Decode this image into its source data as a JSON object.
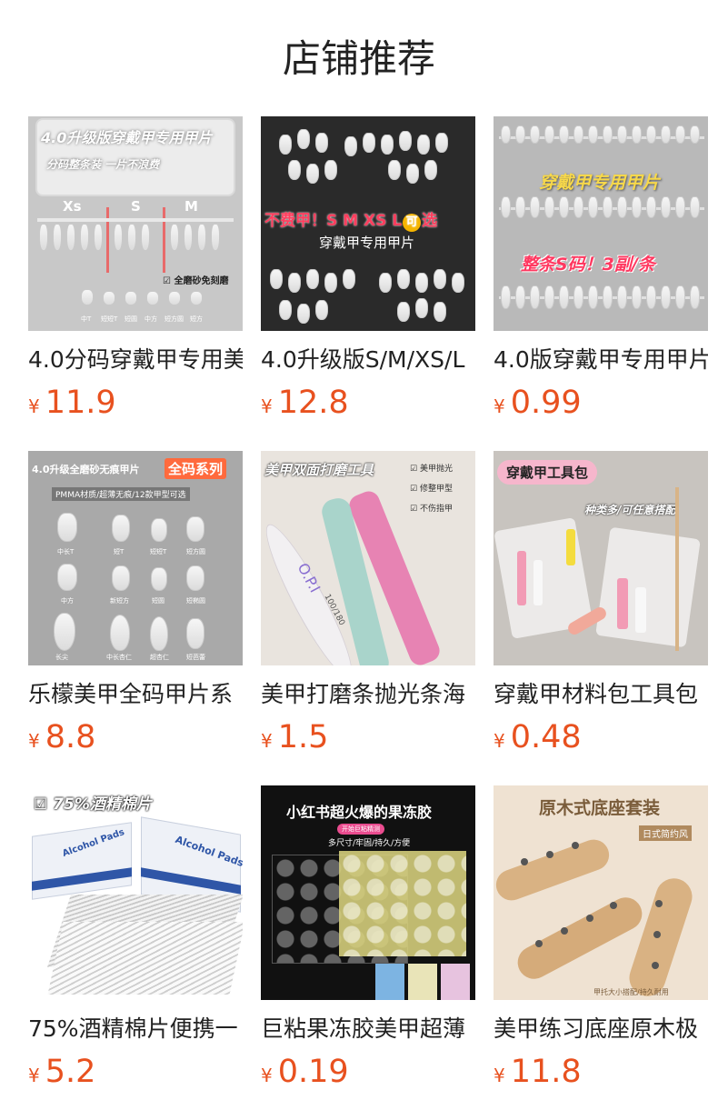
{
  "section": {
    "title": "店铺推荐"
  },
  "products": [
    {
      "name": "4.0分码穿戴甲专用美",
      "currency": "¥",
      "price": "11.9",
      "image_text": {
        "banner": "4.0升级版穿戴甲专用甲片",
        "sub": "分码整条装 一片不浪费",
        "sizes": [
          "Xs",
          "S",
          "M"
        ],
        "check": "全磨砂免刻磨",
        "shapes": [
          "中T",
          "短短T",
          "短圆",
          "中方",
          "短方圆",
          "短方"
        ]
      },
      "colors": {
        "bg": "#c8c8c8"
      }
    },
    {
      "name": "4.0升级版S/M/XS/L",
      "currency": "¥",
      "price": "12.8",
      "image_text": {
        "banner": "不费甲！S M XS L",
        "badge": "可",
        "banner_end": "选",
        "sub": "穿戴甲专用甲片"
      },
      "colors": {
        "bg": "#2a2a2a"
      }
    },
    {
      "name": "4.0版穿戴甲专用甲片",
      "currency": "¥",
      "price": "0.99",
      "image_text": {
        "banner": "穿戴甲专用甲片",
        "sub": "整条S码！3副/条"
      },
      "colors": {
        "bg": "#b9b9b9"
      }
    },
    {
      "name": "乐檬美甲全码甲片系",
      "currency": "¥",
      "price": "8.8",
      "image_text": {
        "banner": "4.0升级全磨砂无痕甲片",
        "badge": "全码系列",
        "sub": "PMMA材质/超薄无痕/12款甲型可选",
        "shapes": [
          "中长T",
          "短T",
          "短短T",
          "短方圆",
          "中方",
          "新短方",
          "短圆",
          "短椭圆",
          "长尖",
          "中长杏仁",
          "超杏仁",
          "短芭蕾"
        ]
      },
      "colors": {
        "bg": "#a9a9a9"
      }
    },
    {
      "name": "美甲打磨条抛光条海",
      "currency": "¥",
      "price": "1.5",
      "image_text": {
        "banner": "美甲双面打磨工具",
        "checks": [
          "美甲抛光",
          "修整甲型",
          "不伤指甲"
        ],
        "brand": "O.P.I",
        "grit": "100/180"
      },
      "colors": {
        "bg": "#e9e4de"
      }
    },
    {
      "name": "穿戴甲材料包工具包",
      "currency": "¥",
      "price": "0.48",
      "image_text": {
        "banner": "穿戴甲工具包",
        "sub": "种类多/可任意搭配"
      },
      "colors": {
        "bg": "#c8c4bf"
      }
    },
    {
      "name": "75%酒精棉片便携一",
      "currency": "¥",
      "price": "5.2",
      "image_text": {
        "banner": "75%酒精棉片",
        "box": "Alcohol Pads"
      },
      "colors": {
        "bg": "#ffffff"
      }
    },
    {
      "name": "巨粘果冻胶美甲超薄",
      "currency": "¥",
      "price": "0.19",
      "image_text": {
        "banner": "小红书超火爆的果冻胶",
        "badge": "开始巨粘精测",
        "sub": "多尺寸/牢固/持久/方便"
      },
      "colors": {
        "bg": "#111111"
      }
    },
    {
      "name": "美甲练习底座原木极",
      "currency": "¥",
      "price": "11.8",
      "image_text": {
        "banner": "原木式底座套装",
        "sub": "日式简约风",
        "foot": "甲托大小搭配/持久耐用"
      },
      "colors": {
        "bg": "#efe2d2"
      }
    }
  ]
}
